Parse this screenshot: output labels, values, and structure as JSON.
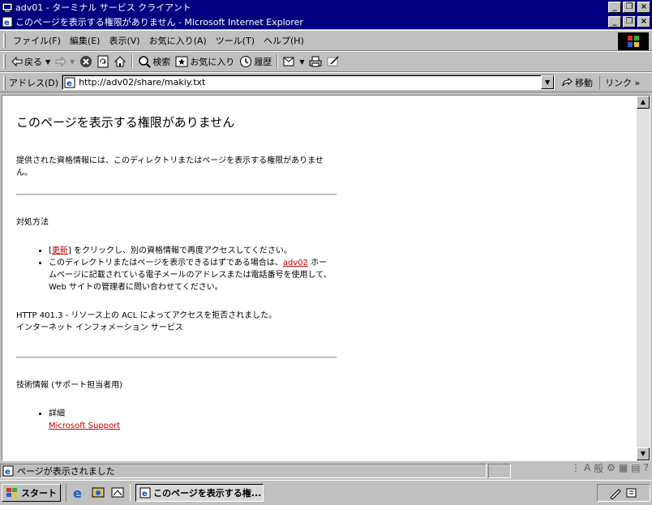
{
  "rdp_window": {
    "title": "adv01 - ターミナル サービス クライアント"
  },
  "ie_window": {
    "title": "このページを表示する権限がありません - Microsoft Internet Explorer"
  },
  "menu": [
    "ファイル(F)",
    "編集(E)",
    "表示(V)",
    "お気に入り(A)",
    "ツール(T)",
    "ヘルプ(H)"
  ],
  "toolbar": {
    "back": "戻る",
    "search": "検索",
    "favorites": "お気に入り",
    "history": "履歴"
  },
  "address": {
    "label": "アドレス(D)",
    "url": "http://adv02/share/makiy.txt",
    "go": "移動",
    "links": "リンク"
  },
  "page": {
    "heading": "このページを表示する権限がありません",
    "intro": "提供された資格情報には、このディレクトリまたはページを表示する権限がありません。",
    "remedy_title": "対処方法",
    "bullet1_pre": "[",
    "bullet1_link": "更新",
    "bullet1_post": "] をクリックし、別の資格情報で再度アクセスしてください。",
    "bullet2_pre": "このディレクトリまたはページを表示できるはずである場合は、",
    "bullet2_link": "adv02",
    "bullet2_post": " ホームページに記載されている電子メールのアドレスまたは電話番号を使用して、Web サイトの管理者に問い合わせてください。",
    "error_line1": "HTTP 401.3 - リソース上の ACL によってアクセスを拒否されました。",
    "error_line2": "インターネット インフォメーション サービス",
    "tech_title": "技術情報 (サポート担当者用)",
    "details_label": "詳細",
    "details_link": "Microsoft Support"
  },
  "status": {
    "text": "ページが表示されました"
  },
  "taskbar": {
    "start": "スタート",
    "task": "このページを表示する権..."
  },
  "colors": {
    "titlebar": "#000080",
    "link": "#c00000",
    "chrome": "#c0c0c0"
  }
}
